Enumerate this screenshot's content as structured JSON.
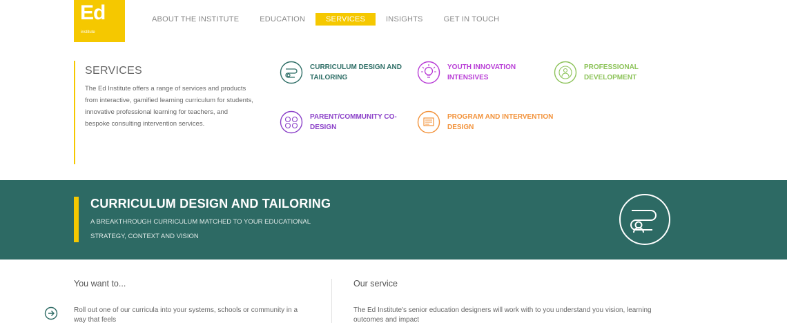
{
  "logo": {
    "main": "Ed",
    "sub": "institute"
  },
  "nav": {
    "items": [
      {
        "label": "ABOUT THE INSTITUTE"
      },
      {
        "label": "EDUCATION"
      },
      {
        "label": "SERVICES"
      },
      {
        "label": "INSIGHTS"
      },
      {
        "label": "GET IN TOUCH"
      }
    ],
    "active_index": 2
  },
  "services": {
    "title": "SERVICES",
    "description": "The Ed Institute offers a range of services and products from interactive, gamified learning curriculum for students, innovative professional learning for teachers, and bespoke consulting intervention services.",
    "items": [
      {
        "label": "CURRICULUM DESIGN AND TAILORING",
        "color": "#2e6e66",
        "icon": "curriculum-icon"
      },
      {
        "label": "YOUTH INNOVATION INTENSIVES",
        "color": "#b83cd6",
        "icon": "lightbulb-icon"
      },
      {
        "label": "PROFESSIONAL DEVELOPMENT",
        "color": "#8dc35a",
        "icon": "professional-development-icon"
      },
      {
        "label": "PARENT/COMMUNITY CO-DESIGN",
        "color": "#8a3fc8",
        "icon": "community-icon"
      },
      {
        "label": "PROGRAM AND INTERVENTION DESIGN",
        "color": "#f2923a",
        "icon": "program-icon"
      }
    ]
  },
  "hero": {
    "title": "CURRICULUM DESIGN AND TAILORING",
    "subtitle": "A BREAKTHROUGH CURRICULUM MATCHED TO YOUR EDUCATIONAL STRATEGY, CONTEXT AND VISION",
    "icon": "curriculum-icon",
    "bg_color": "#2d6a64",
    "accent_color": "#f5c800"
  },
  "content": {
    "left_title": "You want to...",
    "left_item": "Roll out one of our curricula into your systems, schools or community in a way that feels",
    "right_title": "Our service",
    "right_text": "The Ed Institute's senior education designers will work with to you understand you vision, learning outcomes and impact"
  },
  "colors": {
    "brand_yellow": "#f5c800",
    "teal": "#2d6a64"
  }
}
